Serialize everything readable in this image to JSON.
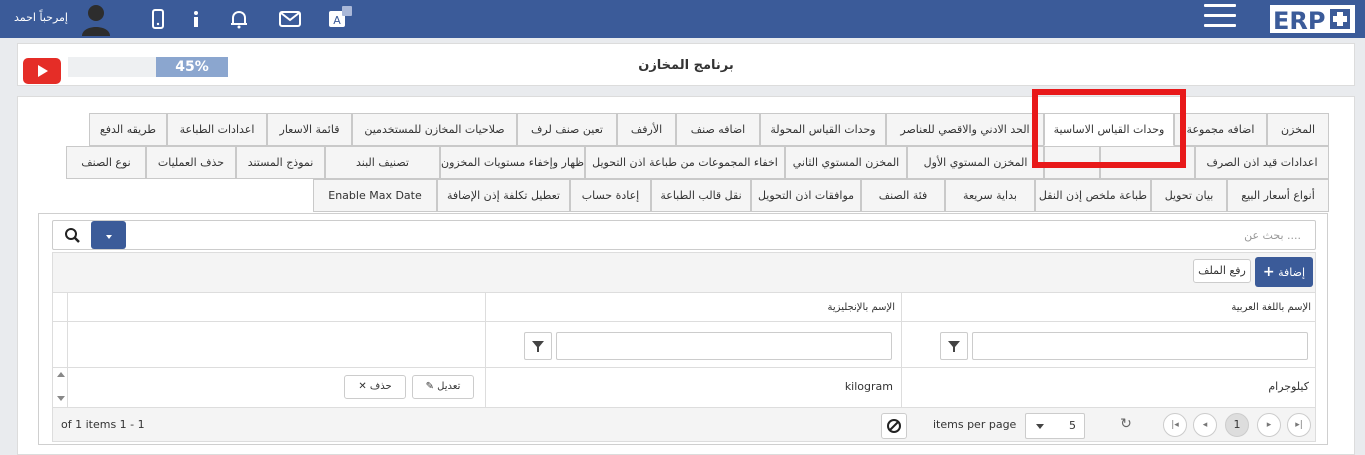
{
  "topbar": {
    "user_name": "إمرحباً احمد",
    "icons": [
      "user-avatar-icon",
      "mobile-icon",
      "info-icon",
      "bell-icon",
      "mail-icon",
      "translate-icon",
      "menu-icon"
    ],
    "logo_alt": "ERP+",
    "bg": "#3b5b99"
  },
  "header": {
    "title": "برنامج المخازن",
    "progress_label": "45%",
    "progress_value": 45
  },
  "tabs": {
    "row1": [
      {
        "label": "المخزن"
      },
      {
        "label": "اضافه مجموعة"
      },
      {
        "label": "وحدات القياس الاساسية",
        "active": true
      },
      {
        "label": "الحد الادني والاقصي للعناصر"
      },
      {
        "label": "وحدات القياس المحولة"
      },
      {
        "label": "اضافه صنف"
      },
      {
        "label": "الأرفف"
      },
      {
        "label": "تعين صنف لرف"
      },
      {
        "label": "صلاحيات المخازن للمستخدمين"
      },
      {
        "label": "قائمة الاسعار"
      },
      {
        "label": "اعدادات الطباعة"
      },
      {
        "label": "طريقه الدفع"
      }
    ],
    "row2": [
      {
        "label": "اعدادات قيد اذن الصرف"
      },
      {
        "label": "المخزن المستوي الأول"
      },
      {
        "label": "المخزن المستوي الثاني"
      },
      {
        "label": "اخفاء المجموعات من طباعة اذن التحويل"
      },
      {
        "label": "إظهار وإخفاء مستويات المخزون"
      },
      {
        "label": "تصنيف البند"
      },
      {
        "label": "نموذج المستند"
      },
      {
        "label": "حذف العمليات"
      },
      {
        "label": "نوع الصنف"
      }
    ],
    "row3": [
      {
        "label": "أنواع أسعار البيع"
      },
      {
        "label": "بيان تحويل"
      },
      {
        "label": "طباعة ملخص إذن النقل"
      },
      {
        "label": "بداية سريعة"
      },
      {
        "label": "فئة الصنف"
      },
      {
        "label": "موافقات اذن التحويل"
      },
      {
        "label": "نقل قالب الطباعة"
      },
      {
        "label": "إعادة حساب"
      },
      {
        "label": "تعطيل تكلفة إذن الإضافة"
      },
      {
        "label": "Enable Max Date"
      }
    ]
  },
  "grid": {
    "search_placeholder": "بحث عن ....",
    "add_label": "إضافة",
    "upload_label": "رفع الملف",
    "columns": [
      "الإسم باللغة العربية",
      "الإسم بالإنجليزية"
    ],
    "rows": [
      {
        "arabic": "كيلوجرام",
        "english": "kilogram"
      }
    ],
    "edit_label": "تعديل",
    "delete_label": "حذف",
    "pager": {
      "info": "of 1 items 1 - 1",
      "items_per_page_label": "items per page",
      "per_page": "5",
      "current_page": "1"
    }
  }
}
